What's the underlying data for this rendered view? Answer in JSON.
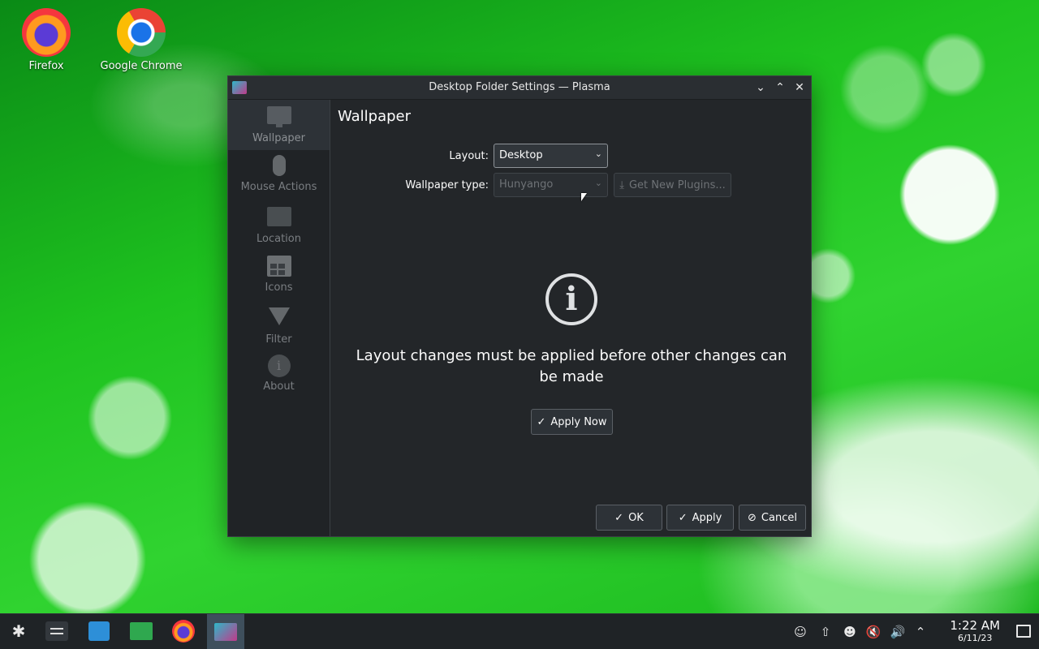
{
  "desktop": {
    "icons": [
      {
        "label": "Firefox",
        "icon": "firefox-icon"
      },
      {
        "label": "Google Chrome",
        "icon": "chrome-icon"
      }
    ]
  },
  "window": {
    "title": "Desktop Folder Settings — Plasma",
    "controls": {
      "minimize": "minimize-icon",
      "maximize": "maximize-icon",
      "close": "close-icon"
    },
    "sidebar": {
      "items": [
        {
          "label": "Wallpaper",
          "icon": "monitor-icon",
          "active": true
        },
        {
          "label": "Mouse Actions",
          "icon": "mouse-icon",
          "active": false
        },
        {
          "label": "Location",
          "icon": "folder-icon",
          "active": false
        },
        {
          "label": "Icons",
          "icon": "icon-grid-icon",
          "active": false
        },
        {
          "label": "Filter",
          "icon": "filter-icon",
          "active": false
        },
        {
          "label": "About",
          "icon": "info-icon",
          "active": false
        }
      ]
    },
    "page_title": "Wallpaper",
    "form": {
      "layout_label": "Layout:",
      "layout_value": "Desktop",
      "wallpaper_type_label": "Wallpaper type:",
      "wallpaper_type_value": "Hunyango",
      "get_plugins_label": "Get New Plugins..."
    },
    "message": "Layout changes must be applied before other changes can be made",
    "apply_now_label": "Apply Now",
    "footer": {
      "ok_label": "OK",
      "apply_label": "Apply",
      "cancel_label": "Cancel"
    }
  },
  "taskbar": {
    "clock": {
      "time": "1:22 AM",
      "date": "6/11/23"
    },
    "tray_icons": [
      "user-icon",
      "update-icon",
      "network-user-icon",
      "muted-speaker-icon",
      "volume-icon",
      "expand-arrow-icon"
    ]
  },
  "colors": {
    "window_bg": "#232629",
    "sidebar_bg": "#202326",
    "taskbar_bg": "#1f2326",
    "desktop_green": "#1ec21f"
  }
}
